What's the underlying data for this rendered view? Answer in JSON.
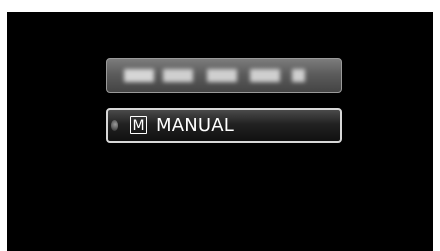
{
  "menu": {
    "items": [
      {
        "id": "auto",
        "label_obscured": true
      },
      {
        "id": "manual",
        "icon_letter": "M",
        "label": "MANUAL"
      }
    ]
  },
  "colors": {
    "screen_background": "#000000",
    "item_text": "#ffffff",
    "selected_border": "#d8d8d8"
  },
  "icons": {
    "manual_mode": "m-box-icon",
    "selection_cursor": "cursor-dot-icon"
  }
}
